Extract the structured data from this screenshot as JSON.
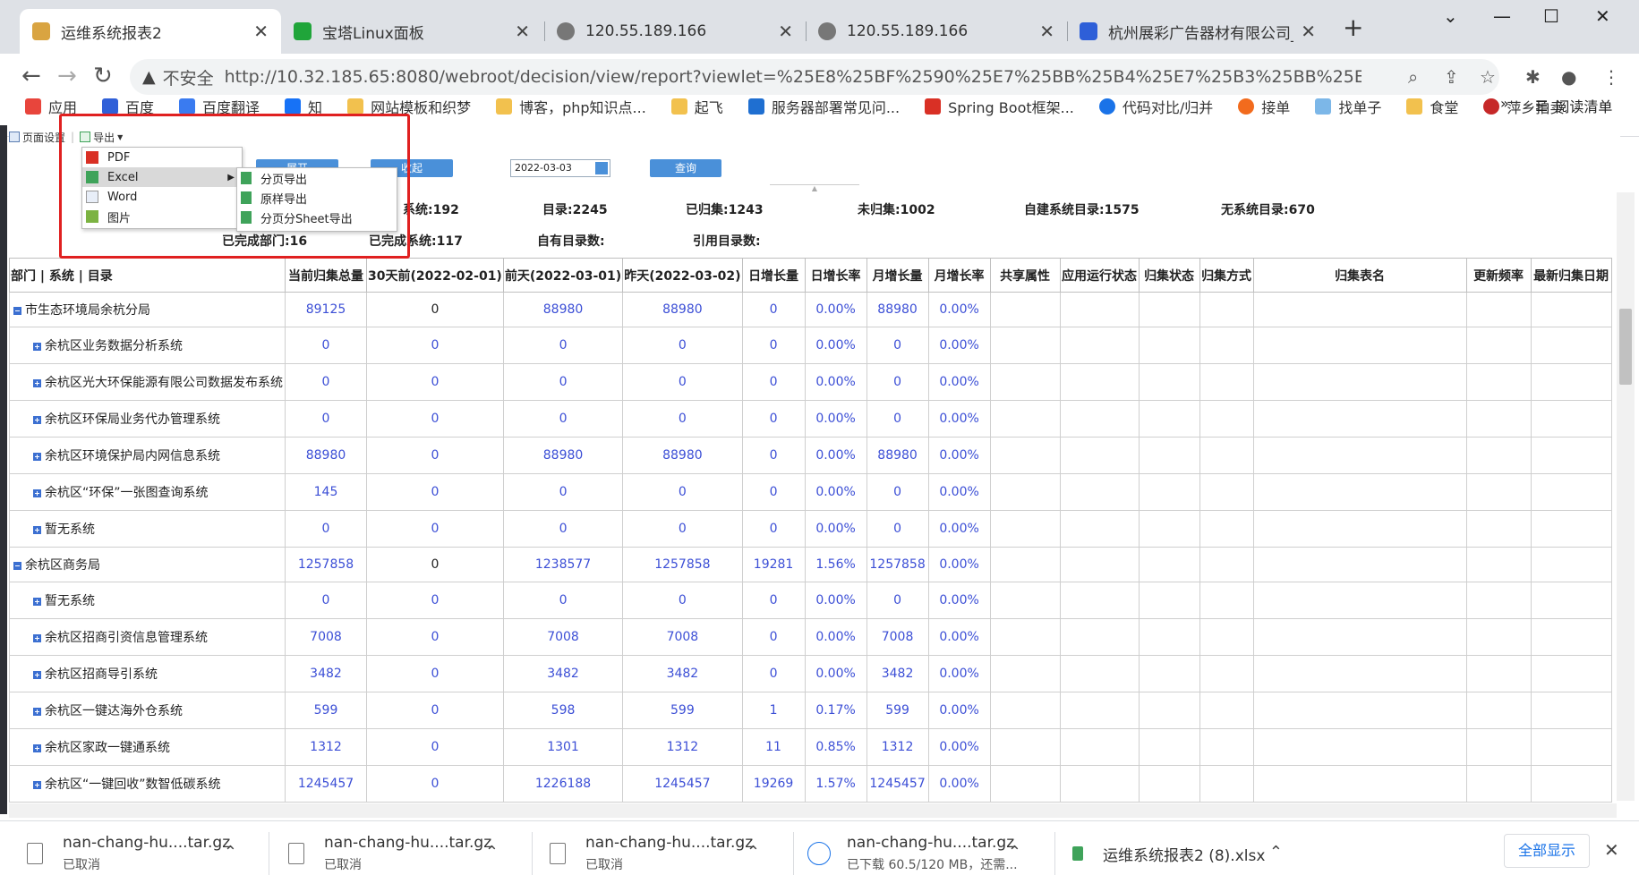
{
  "tabs": [
    {
      "title": "运维系统报表2",
      "active": true
    },
    {
      "title": "宝塔Linux面板",
      "active": false
    },
    {
      "title": "120.55.189.166",
      "active": false
    },
    {
      "title": "120.55.189.166",
      "active": false
    },
    {
      "title": "杭州展彩广告器材有限公司_百度",
      "active": false
    }
  ],
  "window": {
    "new_tab": "+",
    "minimize": "⌄",
    "min": "—",
    "max": "☐",
    "close": "✕"
  },
  "address": {
    "insecure_label": "不安全",
    "url": "http://10.32.185.65:8080/webroot/decision/view/report?viewlet=%25E8%25BF%2590%25E7%25BB%25B4%25E7%25B3%25BB%25E7%25BB%259F%25E6..."
  },
  "bookmarks": [
    {
      "label": "应用",
      "color": "#e8453c"
    },
    {
      "label": "百度",
      "color": "#3060d8"
    },
    {
      "label": "百度翻译",
      "color": "#3a7bf0"
    },
    {
      "label": "知",
      "color": "#1772f6"
    },
    {
      "label": "网站模板和织梦",
      "color": "#f2c14e"
    },
    {
      "label": "博客，php知识点...",
      "color": "#f2c14e"
    },
    {
      "label": "起飞",
      "color": "#f2c14e"
    },
    {
      "label": "服务器部署常见问...",
      "color": "#1f6fd1"
    },
    {
      "label": "Spring Boot框架...",
      "color": "#d93025"
    },
    {
      "label": "代码对比/归并",
      "color": "#1a73e8"
    },
    {
      "label": "接单",
      "color": "#f26b1d"
    },
    {
      "label": "找单子",
      "color": "#7cb7e8"
    },
    {
      "label": "食堂",
      "color": "#f2c14e"
    },
    {
      "label": "萍乡拍卖",
      "color": "#c62828"
    }
  ],
  "bookmarks_more": "»",
  "reading_list": "阅读清单",
  "report_toolbar": {
    "page_setup": "页面设置",
    "export": "导出"
  },
  "export_menu": {
    "items": [
      "PDF",
      "Excel",
      "Word",
      "图片"
    ],
    "excel_submenu": [
      "分页导出",
      "原样导出",
      "分页分Sheet导出"
    ]
  },
  "params": {
    "expand": "展开",
    "collapse": "收起",
    "date": "2022-03-03",
    "query": "查询"
  },
  "stats_row1": [
    "系统:192",
    "目录:2245",
    "已归集:1243",
    "未归集:1002",
    "自建系统目录:1575",
    "无系统目录:670"
  ],
  "stats_row2": [
    "已完成部门:16",
    "已完成系统:117",
    "自有目录数:",
    "引用目录数:"
  ],
  "table": {
    "headers": [
      "部门 | 系统 | 目录",
      "当前归集总量",
      "30天前(2022-02-01)",
      "前天(2022-03-01)",
      "昨天(2022-03-02)",
      "日增长量",
      "日增长率",
      "月增长量",
      "月增长率",
      "共享属性",
      "应用运行状态",
      "归集状态",
      "归集方式",
      "归集表名",
      "更新频率",
      "最新归集日期"
    ],
    "rows": [
      {
        "level": 0,
        "name": "市生态环境局余杭分局",
        "vals": [
          "89125",
          "0",
          "88980",
          "88980",
          "0",
          "0.00%",
          "88980",
          "0.00%"
        ]
      },
      {
        "level": 1,
        "name": "余杭区业务数据分析系统",
        "vals": [
          "0",
          "0",
          "0",
          "0",
          "0",
          "0.00%",
          "0",
          "0.00%"
        ]
      },
      {
        "level": 1,
        "name": "余杭区光大环保能源有限公司数据发布系统",
        "vals": [
          "0",
          "0",
          "0",
          "0",
          "0",
          "0.00%",
          "0",
          "0.00%"
        ]
      },
      {
        "level": 1,
        "name": "余杭区环保局业务代办管理系统",
        "vals": [
          "0",
          "0",
          "0",
          "0",
          "0",
          "0.00%",
          "0",
          "0.00%"
        ]
      },
      {
        "level": 1,
        "name": "余杭区环境保护局内网信息系统",
        "vals": [
          "88980",
          "0",
          "88980",
          "88980",
          "0",
          "0.00%",
          "88980",
          "0.00%"
        ]
      },
      {
        "level": 1,
        "name": "余杭区“环保”一张图查询系统",
        "vals": [
          "145",
          "0",
          "0",
          "0",
          "0",
          "0.00%",
          "0",
          "0.00%"
        ]
      },
      {
        "level": 1,
        "name": "暂无系统",
        "vals": [
          "0",
          "0",
          "0",
          "0",
          "0",
          "0.00%",
          "0",
          "0.00%"
        ]
      },
      {
        "level": 0,
        "name": "余杭区商务局",
        "vals": [
          "1257858",
          "0",
          "1238577",
          "1257858",
          "19281",
          "1.56%",
          "1257858",
          "0.00%"
        ]
      },
      {
        "level": 1,
        "name": "暂无系统",
        "vals": [
          "0",
          "0",
          "0",
          "0",
          "0",
          "0.00%",
          "0",
          "0.00%"
        ]
      },
      {
        "level": 1,
        "name": "余杭区招商引资信息管理系统",
        "vals": [
          "7008",
          "0",
          "7008",
          "7008",
          "0",
          "0.00%",
          "7008",
          "0.00%"
        ]
      },
      {
        "level": 1,
        "name": "余杭区招商导引系统",
        "vals": [
          "3482",
          "0",
          "3482",
          "3482",
          "0",
          "0.00%",
          "3482",
          "0.00%"
        ]
      },
      {
        "level": 1,
        "name": "余杭区一键达海外仓系统",
        "vals": [
          "599",
          "0",
          "598",
          "599",
          "1",
          "0.17%",
          "599",
          "0.00%"
        ]
      },
      {
        "level": 1,
        "name": "余杭区家政一键通系统",
        "vals": [
          "1312",
          "0",
          "1301",
          "1312",
          "11",
          "0.85%",
          "1312",
          "0.00%"
        ]
      },
      {
        "level": 1,
        "name": "余杭区“一键回收”数智低碳系统",
        "vals": [
          "1245457",
          "0",
          "1226188",
          "1245457",
          "19269",
          "1.57%",
          "1245457",
          "0.00%"
        ]
      }
    ]
  },
  "downloads": [
    {
      "file": "nan-chang-hu....tar.gz",
      "status": "已取消"
    },
    {
      "file": "nan-chang-hu....tar.gz",
      "status": "已取消"
    },
    {
      "file": "nan-chang-hu....tar.gz",
      "status": "已取消"
    },
    {
      "file": "nan-chang-hu....tar.gz",
      "status": "已下载 60.5/120 MB，还需..."
    },
    {
      "file": "运维系统报表2 (8).xlsx",
      "status": ""
    }
  ],
  "show_all": "全部显示"
}
